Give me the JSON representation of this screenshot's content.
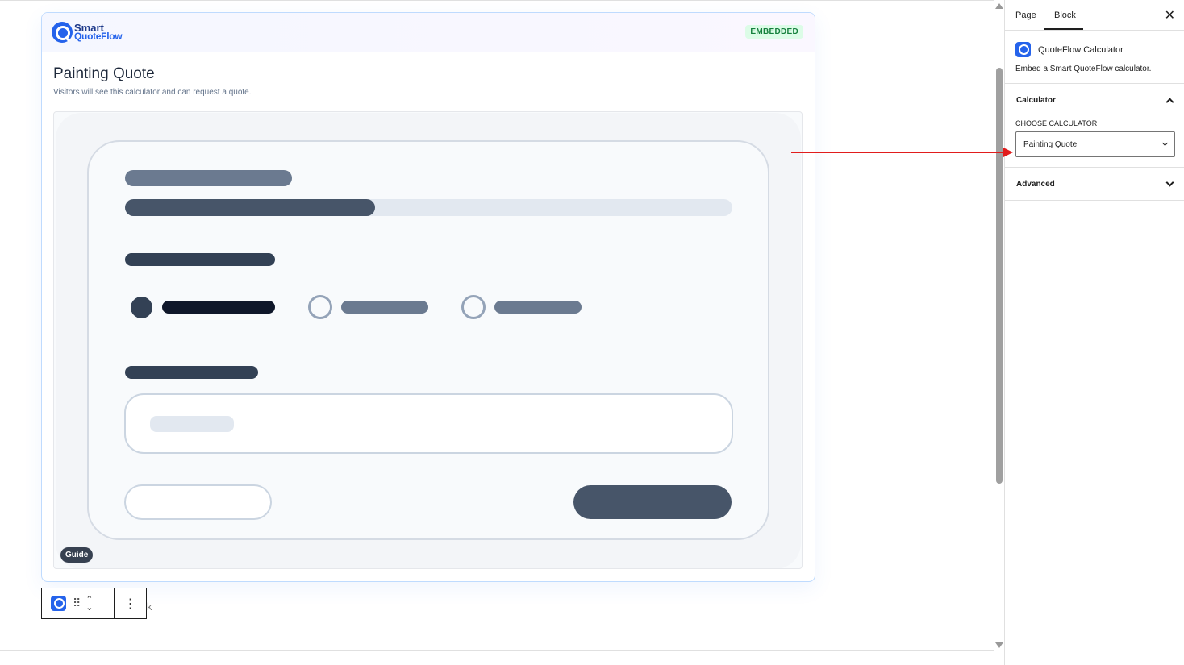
{
  "editor": {
    "block": {
      "logo": {
        "line1": "Smart",
        "line2": "QuoteFlow"
      },
      "badge": "EMBEDDED",
      "title": "Painting Quote",
      "subtitle": "Visitors will see this calculator and can request a quote.",
      "guide_label": "Guide"
    },
    "toolbar": {
      "drag_glyph": "⠿",
      "up_glyph": "⌃",
      "down_glyph": "⌄",
      "more_glyph": "⋮"
    },
    "stray_text": "k"
  },
  "sidebar": {
    "tabs": [
      {
        "label": "Page"
      },
      {
        "label": "Block"
      }
    ],
    "close_glyph": "✕",
    "block_card": {
      "title": "QuoteFlow Calculator",
      "description": "Embed a Smart QuoteFlow calculator."
    },
    "calculator_panel": {
      "title": "Calculator",
      "field_label": "CHOOSE CALCULATOR",
      "selected_value": "Painting Quote"
    },
    "advanced_panel": {
      "title": "Advanced"
    }
  },
  "colors": {
    "accent": "#2563eb",
    "badge_bg": "#dcfce7",
    "badge_text": "#15803d",
    "annotation_arrow": "#e11d1d"
  },
  "icons": [
    "smart-quoteflow-logo",
    "drag-handle-icon",
    "move-up-icon",
    "move-down-icon",
    "more-options-icon",
    "close-icon",
    "chevron-up-icon",
    "chevron-down-icon"
  ]
}
